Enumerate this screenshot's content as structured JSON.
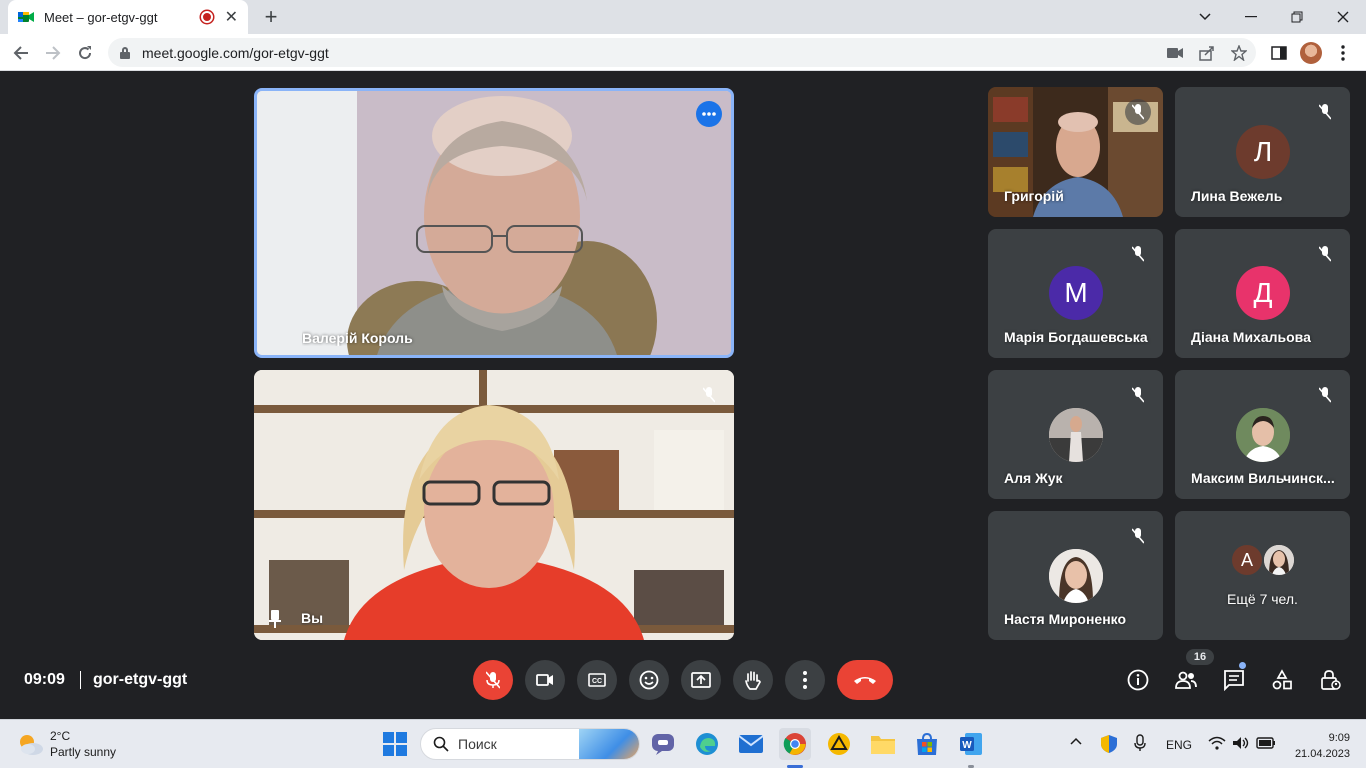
{
  "browser": {
    "tab_title": "Meet – gor-etgv-ggt",
    "url": "meet.google.com/gor-etgv-ggt",
    "new_tab_label": "+"
  },
  "meet": {
    "pinned": [
      {
        "name": "Валерій Король"
      },
      {
        "name": "Вы"
      }
    ],
    "participants": [
      {
        "name": "Григорій",
        "initial": ""
      },
      {
        "name": "Лина Вежель",
        "initial": "Л",
        "color": "#6d3b2d"
      },
      {
        "name": "Марія Богдашевська",
        "initial": "М",
        "color": "#4b2aa8"
      },
      {
        "name": "Діана Михальова",
        "initial": "Д",
        "color": "#e8336b"
      },
      {
        "name": "Аля Жук",
        "initial": ""
      },
      {
        "name": "Максим Вильчинск...",
        "initial": ""
      },
      {
        "name": "Настя Мироненко",
        "initial": ""
      },
      {
        "name": "Ещё 7 чел.",
        "initial": "A",
        "color": "#6d3b2d"
      }
    ],
    "time": "09:09",
    "meeting_code": "gor-etgv-ggt",
    "participant_count": "16"
  },
  "taskbar": {
    "weather_temp": "2°C",
    "weather_desc": "Partly sunny",
    "search_placeholder": "Поиск",
    "language": "ENG",
    "clock_time": "9:09",
    "clock_date": "21.04.2023"
  }
}
